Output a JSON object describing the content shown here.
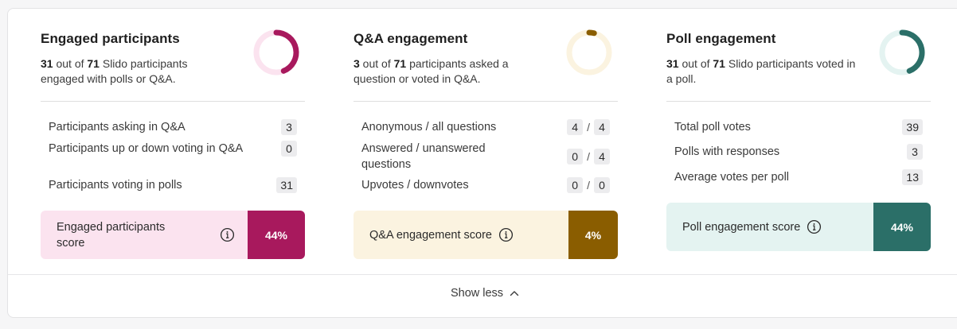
{
  "cards": [
    {
      "title": "Engaged participants",
      "desc": {
        "count": "31",
        "t1": " out of ",
        "total": "71",
        "t2": " Slido participants engaged with polls or Q&A."
      },
      "ring_fraction": 0.44,
      "ring_color": "#a8195d",
      "ring_track": "#fbe3ef",
      "stats": [
        {
          "label": "Participants asking in Q&A",
          "value": "3"
        },
        {
          "label": "Participants up or down voting in Q&A",
          "value": "0"
        },
        {
          "label": "Participants voting in polls",
          "value": "31"
        }
      ],
      "score": {
        "label": "Engaged participants score",
        "value": "44%",
        "bg": "#fbe3ef",
        "accent": "#a8195d"
      }
    },
    {
      "title": "Q&A engagement",
      "desc": {
        "count": "3",
        "t1": " out of ",
        "total": "71",
        "t2": " participants asked a question or voted in Q&A."
      },
      "ring_fraction": 0.04,
      "ring_color": "#8a5d00",
      "ring_track": "#fbf3e0",
      "stats": [
        {
          "label": "Anonymous / all questions",
          "a": "4",
          "b": "4"
        },
        {
          "label": "Answered / unanswered questions",
          "a": "0",
          "b": "4"
        },
        {
          "label": "Upvotes / downvotes",
          "a": "0",
          "b": "0"
        }
      ],
      "score": {
        "label": "Q&A engagement score",
        "value": "4%",
        "bg": "#fbf3e0",
        "accent": "#8a5d00"
      }
    },
    {
      "title": "Poll engagement",
      "desc": {
        "count": "31",
        "t1": " out of ",
        "total": "71",
        "t2": " Slido participants voted in a poll."
      },
      "ring_fraction": 0.44,
      "ring_color": "#2b6f68",
      "ring_track": "#e4f3f1",
      "stats": [
        {
          "label": "Total poll votes",
          "value": "39"
        },
        {
          "label": "Polls with responses",
          "value": "3"
        },
        {
          "label": "Average votes per poll",
          "value": "13"
        }
      ],
      "score": {
        "label": "Poll engagement score",
        "value": "44%",
        "bg": "#e4f3f1",
        "accent": "#2b6f68"
      }
    }
  ],
  "footer": {
    "show_less": "Show less",
    "icon": "chevron-up-icon"
  },
  "info_icon": "info-icon"
}
